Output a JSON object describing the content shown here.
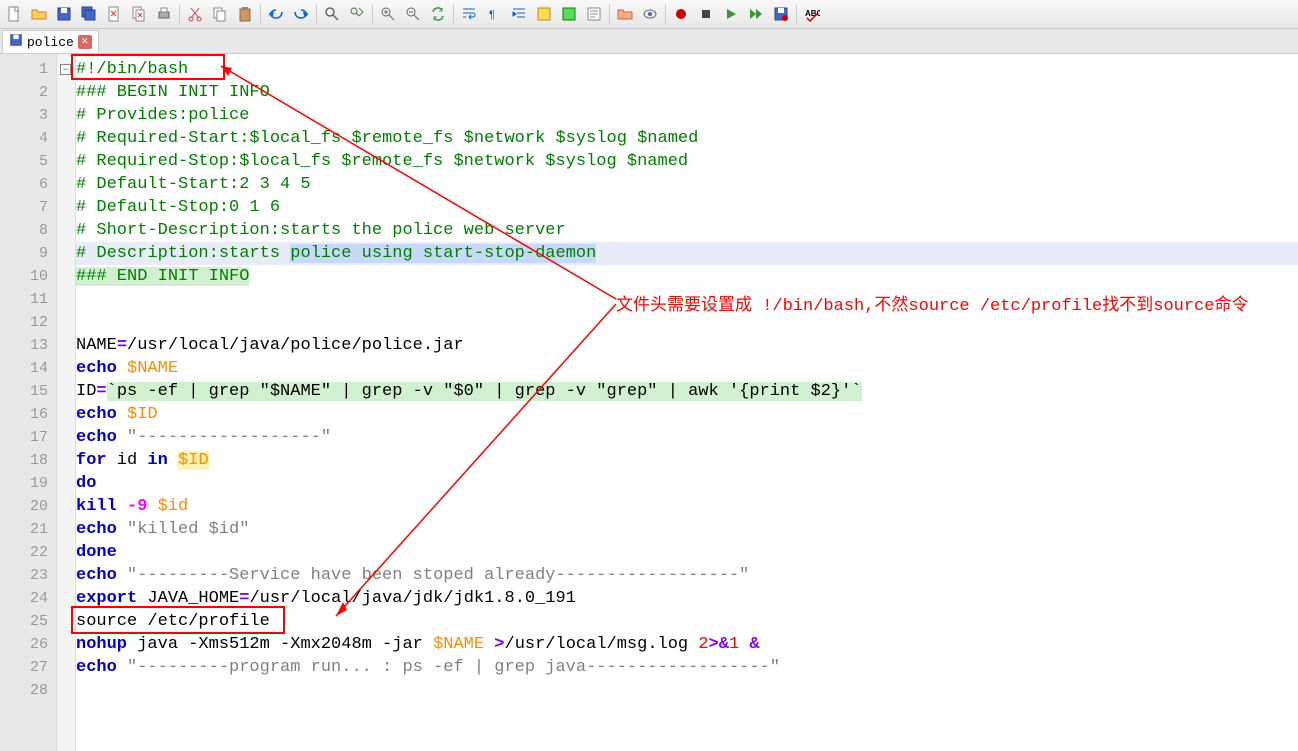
{
  "tab": {
    "filename": "police"
  },
  "annotation": {
    "text": "文件头需要设置成 !/bin/bash,不然source /etc/profile找不到source命令"
  },
  "code": {
    "lines": [
      {
        "n": 1,
        "segs": [
          {
            "t": "#!/bin/bash",
            "cls": "c-comment"
          }
        ]
      },
      {
        "n": 2,
        "segs": [
          {
            "t": "### BEGIN INIT INFO",
            "cls": "c-comment"
          }
        ]
      },
      {
        "n": 3,
        "segs": [
          {
            "t": "# Provides:police",
            "cls": "c-comment"
          }
        ]
      },
      {
        "n": 4,
        "segs": [
          {
            "t": "# Required-Start:$local_fs $remote_fs $network $syslog $named",
            "cls": "c-comment"
          }
        ]
      },
      {
        "n": 5,
        "segs": [
          {
            "t": "# Required-Stop:$local_fs $remote_fs $network $syslog $named",
            "cls": "c-comment"
          }
        ]
      },
      {
        "n": 6,
        "segs": [
          {
            "t": "# Default-Start:2 3 4 5",
            "cls": "c-comment"
          }
        ]
      },
      {
        "n": 7,
        "segs": [
          {
            "t": "# Default-Stop:0 1 6",
            "cls": "c-comment"
          }
        ]
      },
      {
        "n": 8,
        "segs": [
          {
            "t": "# Short-Description:starts the police web server",
            "cls": "c-comment"
          }
        ]
      },
      {
        "n": 9,
        "segs": [
          {
            "t": "# Description:starts ",
            "cls": "c-comment"
          },
          {
            "t": "police using start-stop-daemon",
            "cls": "c-comment hl-sel"
          }
        ]
      },
      {
        "n": 10,
        "segs": [
          {
            "t": "### END INIT INFO",
            "cls": "c-comment hl-grn"
          }
        ]
      },
      {
        "n": 11,
        "segs": []
      },
      {
        "n": 12,
        "segs": []
      },
      {
        "n": 13,
        "segs": [
          {
            "t": "NAME",
            "cls": ""
          },
          {
            "t": "=",
            "cls": "c-op"
          },
          {
            "t": "/usr/local/java/police/police.jar",
            "cls": ""
          }
        ]
      },
      {
        "n": 14,
        "segs": [
          {
            "t": "echo",
            "cls": "c-kw"
          },
          {
            "t": " ",
            "cls": ""
          },
          {
            "t": "$NAME",
            "cls": "c-var"
          }
        ]
      },
      {
        "n": 15,
        "segs": [
          {
            "t": "ID",
            "cls": ""
          },
          {
            "t": "=",
            "cls": "c-op"
          },
          {
            "t": "`",
            "cls": "hl-grn"
          },
          {
            "t": "ps -ef | grep \"$NAME\" | grep -v \"$0\" | grep -v \"grep\" | awk '{print $2}'",
            "cls": "hl-grn"
          },
          {
            "t": "`",
            "cls": "hl-grn"
          }
        ]
      },
      {
        "n": 16,
        "segs": [
          {
            "t": "echo",
            "cls": "c-kw"
          },
          {
            "t": " ",
            "cls": ""
          },
          {
            "t": "$ID",
            "cls": "c-var"
          }
        ]
      },
      {
        "n": 17,
        "segs": [
          {
            "t": "echo",
            "cls": "c-kw"
          },
          {
            "t": " ",
            "cls": ""
          },
          {
            "t": "\"------------------\"",
            "cls": "c-str"
          }
        ]
      },
      {
        "n": 18,
        "segs": [
          {
            "t": "for",
            "cls": "c-kw"
          },
          {
            "t": " id ",
            "cls": ""
          },
          {
            "t": "in",
            "cls": "c-kw"
          },
          {
            "t": " ",
            "cls": ""
          },
          {
            "t": "$ID",
            "cls": "c-var hl-yel"
          }
        ]
      },
      {
        "n": 19,
        "segs": [
          {
            "t": "do",
            "cls": "c-kw"
          }
        ]
      },
      {
        "n": 20,
        "segs": [
          {
            "t": "kill",
            "cls": "c-kw"
          },
          {
            "t": " ",
            "cls": ""
          },
          {
            "t": "-9",
            "cls": "c-neg"
          },
          {
            "t": " ",
            "cls": ""
          },
          {
            "t": "$id",
            "cls": "c-var"
          }
        ]
      },
      {
        "n": 21,
        "segs": [
          {
            "t": "echo",
            "cls": "c-kw"
          },
          {
            "t": " ",
            "cls": ""
          },
          {
            "t": "\"killed $id\"",
            "cls": "c-str"
          }
        ]
      },
      {
        "n": 22,
        "segs": [
          {
            "t": "done",
            "cls": "c-kw"
          }
        ]
      },
      {
        "n": 23,
        "segs": [
          {
            "t": "echo",
            "cls": "c-kw"
          },
          {
            "t": " ",
            "cls": ""
          },
          {
            "t": "\"---------Service have been stoped already------------------\"",
            "cls": "c-str"
          }
        ]
      },
      {
        "n": 24,
        "segs": [
          {
            "t": "export",
            "cls": "c-kw"
          },
          {
            "t": " JAVA_HOME",
            "cls": ""
          },
          {
            "t": "=",
            "cls": "c-op"
          },
          {
            "t": "/usr/local/java/jdk/jdk1.8.0_191",
            "cls": ""
          }
        ]
      },
      {
        "n": 25,
        "segs": [
          {
            "t": "source /etc/profile",
            "cls": ""
          }
        ]
      },
      {
        "n": 26,
        "segs": [
          {
            "t": "nohup",
            "cls": "c-kw"
          },
          {
            "t": " java -Xms512m -Xmx2048m -jar ",
            "cls": ""
          },
          {
            "t": "$NAME",
            "cls": "c-var"
          },
          {
            "t": " ",
            "cls": ""
          },
          {
            "t": ">",
            "cls": "c-op"
          },
          {
            "t": "/usr/local/msg.log ",
            "cls": ""
          },
          {
            "t": "2",
            "cls": "c-num"
          },
          {
            "t": ">&",
            "cls": "c-op"
          },
          {
            "t": "1",
            "cls": "c-num"
          },
          {
            "t": " ",
            "cls": ""
          },
          {
            "t": "&",
            "cls": "c-op"
          }
        ]
      },
      {
        "n": 27,
        "segs": [
          {
            "t": "echo",
            "cls": "c-kw"
          },
          {
            "t": " ",
            "cls": ""
          },
          {
            "t": "\"---------program run... : ps -ef | grep java------------------\"",
            "cls": "c-str"
          }
        ]
      },
      {
        "n": 28,
        "segs": []
      }
    ]
  },
  "toolbar_icons": [
    "new",
    "open",
    "save",
    "saveall",
    "close",
    "closeall",
    "print",
    "cut",
    "copy",
    "paste",
    "undo",
    "redo",
    "find",
    "replace",
    "zoomin",
    "zoomout",
    "sync",
    "wrap",
    "showall",
    "indent",
    "func1",
    "func2",
    "folder",
    "eye",
    "record",
    "stop",
    "play",
    "run",
    "macro",
    "spell"
  ]
}
